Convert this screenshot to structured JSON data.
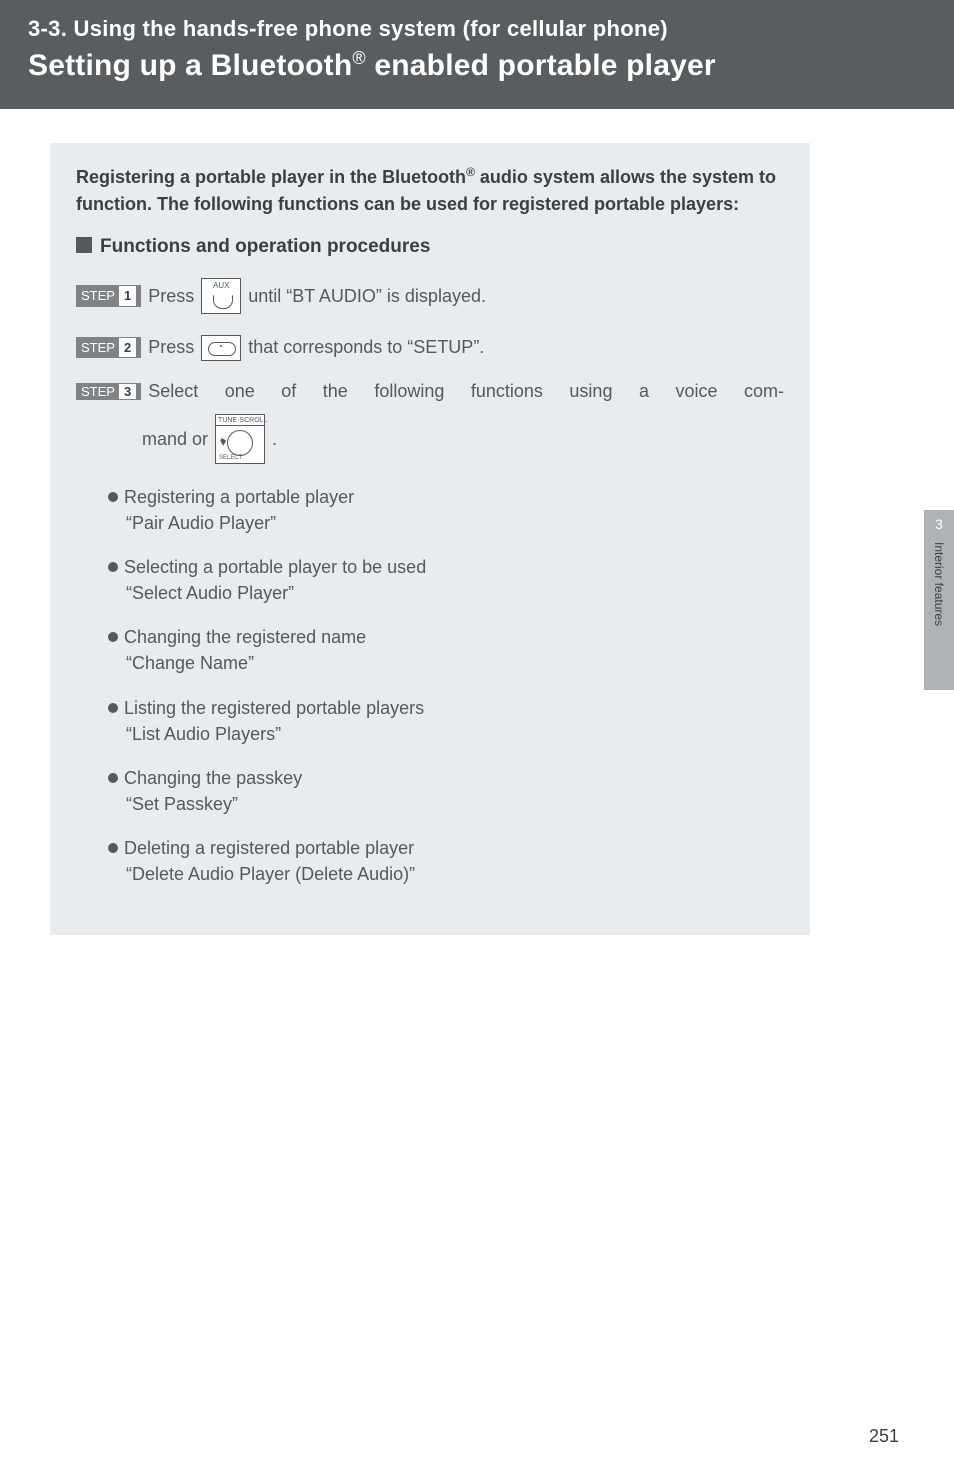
{
  "header": {
    "section_id": "3-3. Using the hands-free phone system (for cellular phone)",
    "title_pre": "Setting up a Bluetooth",
    "title_post": " enabled portable player"
  },
  "intro": {
    "line_pre": "Registering a portable player in the Bluetooth",
    "line_post": " audio system allows the system to function. The following functions can be used for registered portable players:"
  },
  "subheading": "Functions and operation procedures",
  "steps": {
    "label": "STEP",
    "s1": {
      "num": "1",
      "pre": "Press ",
      "post": " until “BT AUDIO” is displayed."
    },
    "s2": {
      "num": "2",
      "pre": "Press ",
      "post": " that corresponds to “SETUP”."
    },
    "s3": {
      "num": "3",
      "text": "Select one of the following functions using a voice com-",
      "tail_pre": "mand or ",
      "tail_post": "."
    }
  },
  "icons": {
    "aux_label": "AUX",
    "knob_top": "TUNE·SCROLL",
    "knob_sel": "SELECT"
  },
  "functions": [
    {
      "title": "Registering a portable player",
      "cmd": "“Pair Audio Player”"
    },
    {
      "title": "Selecting a portable player to be used",
      "cmd": "“Select Audio Player”"
    },
    {
      "title": "Changing the registered name",
      "cmd": "“Change Name”"
    },
    {
      "title": "Listing the registered portable players",
      "cmd": "“List Audio Players”"
    },
    {
      "title": "Changing the passkey",
      "cmd": "“Set Passkey”"
    },
    {
      "title": "Deleting a registered portable player",
      "cmd": "“Delete Audio Player (Delete Audio)”"
    }
  ],
  "sidetab": {
    "num": "3",
    "label": "Interior features"
  },
  "pagenum": "251"
}
